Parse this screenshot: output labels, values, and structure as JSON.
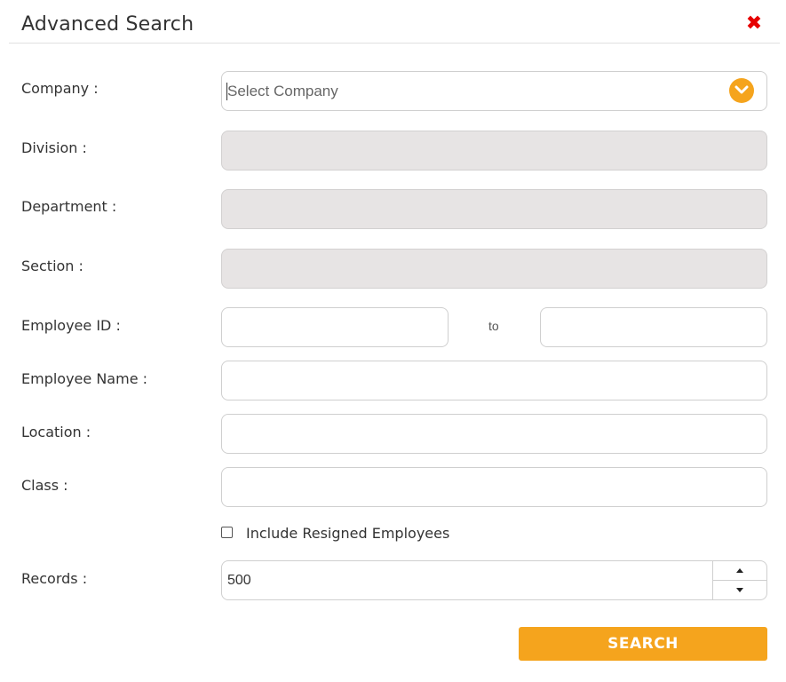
{
  "dialog": {
    "title": "Advanced Search",
    "close_icon": "close-x-icon",
    "close_color": "#e60000"
  },
  "form": {
    "company_label": "Company :",
    "company_placeholder": "Select Company",
    "dropdown_icon": "chevron-down-circle-icon",
    "division_label": "Division :",
    "department_label": "Department :",
    "section_label": "Section :",
    "employee_id_label": "Employee ID :",
    "employee_id_to": "to",
    "employee_name_label": "Employee Name :",
    "location_label": "Location :",
    "class_label": "Class :",
    "include_resigned_label": "Include Resigned Employees",
    "records_label": "Records :",
    "records_value": "500",
    "search_button": "SEARCH"
  },
  "colors": {
    "accent": "#f5a41d",
    "disabled_field": "#e7e4e4"
  }
}
